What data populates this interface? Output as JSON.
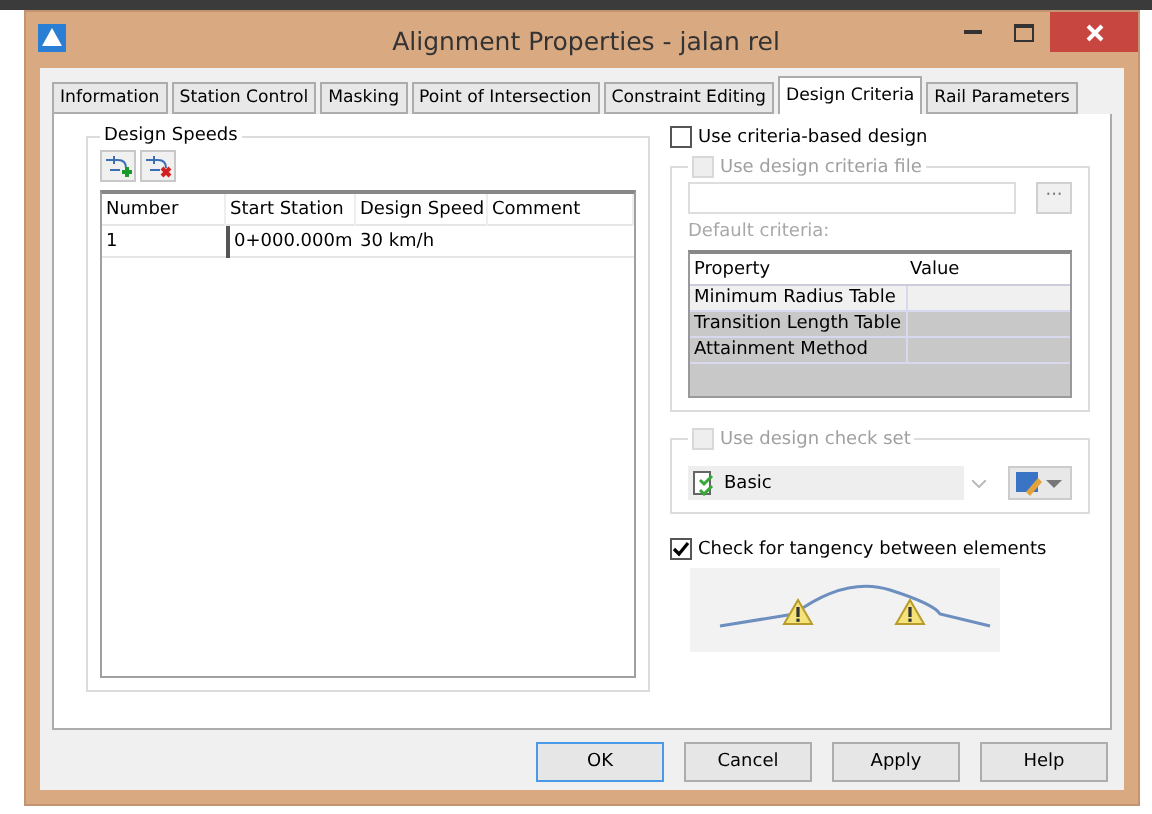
{
  "window": {
    "title": "Alignment Properties - jalan rel"
  },
  "tabs": [
    {
      "label": "Information",
      "selected": false
    },
    {
      "label": "Station Control",
      "selected": false
    },
    {
      "label": "Masking",
      "selected": false
    },
    {
      "label": "Point of Intersection",
      "selected": false
    },
    {
      "label": "Constraint Editing",
      "selected": false
    },
    {
      "label": "Design Criteria",
      "selected": true
    },
    {
      "label": "Rail Parameters",
      "selected": false
    }
  ],
  "design_speeds": {
    "title": "Design Speeds",
    "columns": [
      "Number",
      "Start Station",
      "Design Speed",
      "Comment"
    ],
    "rows": [
      [
        "1",
        "0+000.000m",
        "30 km/h",
        ""
      ]
    ]
  },
  "criteria_based": {
    "label": "Use criteria-based design",
    "checked": false,
    "disabled": false
  },
  "criteria_file": {
    "label": "Use design criteria file",
    "checked": false,
    "disabled": true,
    "browse": "···",
    "default_label": "Default criteria:",
    "columns": [
      "Property",
      "Value"
    ],
    "rows": [
      [
        "Minimum Radius Table"
      ],
      [
        "Transition Length Table"
      ],
      [
        "Attainment Method"
      ]
    ]
  },
  "check_set": {
    "label": "Use design check set",
    "checked": false,
    "disabled": true,
    "value": "Basic"
  },
  "tangency": {
    "label": "Check for tangency between elements",
    "checked": true,
    "disabled": false
  },
  "buttons": [
    {
      "label": "OK",
      "default": true
    },
    {
      "label": "Cancel",
      "default": false
    },
    {
      "label": "Apply",
      "default": false
    },
    {
      "label": "Help",
      "default": false
    }
  ]
}
